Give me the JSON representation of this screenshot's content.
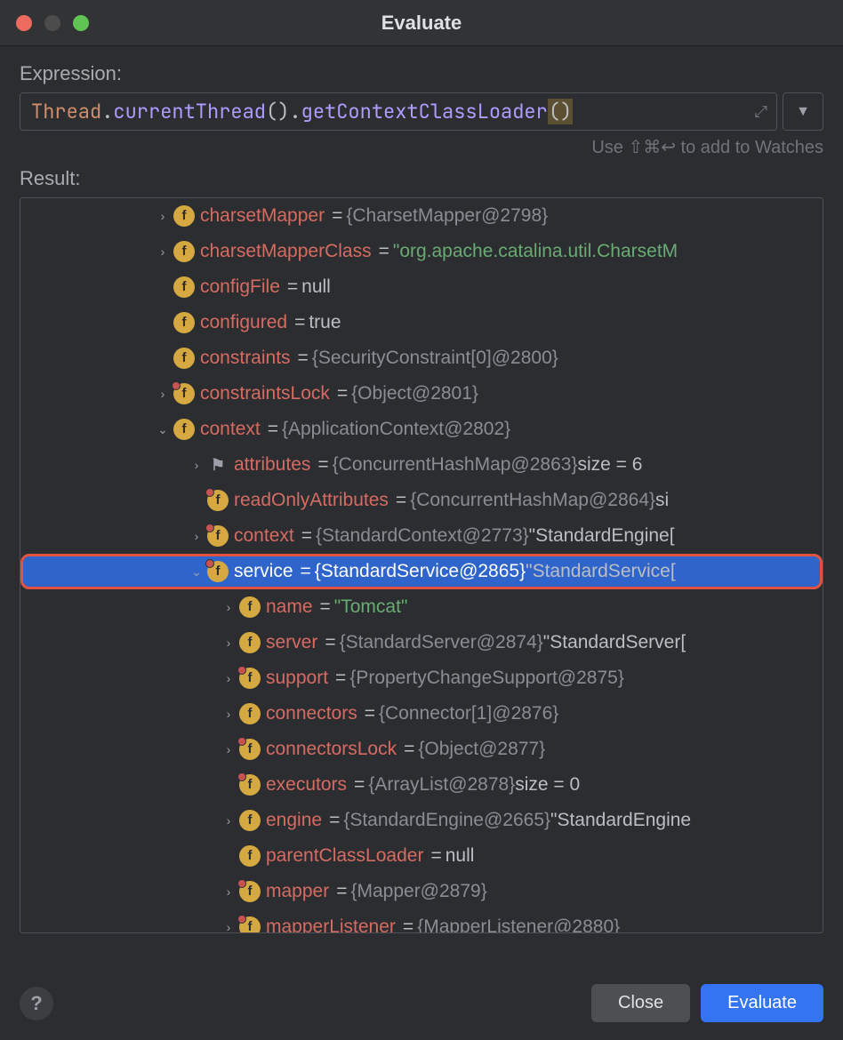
{
  "title": "Evaluate",
  "labels": {
    "expression": "Expression:",
    "result": "Result:",
    "hint": "Use ⇧⌘↩ to add to Watches",
    "close": "Close",
    "evaluate": "Evaluate"
  },
  "expression": {
    "tokens": [
      "Thread",
      ".",
      "currentThread",
      "()",
      ".",
      "getContextClassLoader",
      "()"
    ]
  },
  "rows": [
    {
      "indent": 1,
      "chev": "right",
      "icon": "f",
      "name": "charsetMapper",
      "valType": "obj",
      "val": "{CharsetMapper@2798}"
    },
    {
      "indent": 1,
      "chev": "right",
      "icon": "f",
      "name": "charsetMapperClass",
      "valType": "str",
      "val": "\"org.apache.catalina.util.CharsetM"
    },
    {
      "indent": 1,
      "chev": "none",
      "icon": "f",
      "name": "configFile",
      "valType": "null",
      "val": "null"
    },
    {
      "indent": 1,
      "chev": "none",
      "icon": "f",
      "name": "configured",
      "valType": "bool",
      "val": "true"
    },
    {
      "indent": 1,
      "chev": "none",
      "icon": "f",
      "name": "constraints",
      "valType": "obj",
      "val": "{SecurityConstraint[0]@2800}"
    },
    {
      "indent": 1,
      "chev": "right",
      "icon": "fl",
      "name": "constraintsLock",
      "valType": "obj",
      "val": "{Object@2801}"
    },
    {
      "indent": 1,
      "chev": "down",
      "icon": "f",
      "name": "context",
      "valType": "obj",
      "val": "{ApplicationContext@2802}"
    },
    {
      "indent": 2,
      "chev": "right",
      "icon": "flag",
      "name": "attributes",
      "valType": "obj",
      "val": "{ConcurrentHashMap@2863}",
      "extra": "  size = 6"
    },
    {
      "indent": 2,
      "chev": "none",
      "icon": "fl",
      "name": "readOnlyAttributes",
      "valType": "obj",
      "val": "{ConcurrentHashMap@2864}",
      "extra": "  si"
    },
    {
      "indent": 2,
      "chev": "right",
      "icon": "fl",
      "name": "context",
      "valType": "obj",
      "val": "{StandardContext@2773}",
      "extraPlain": " \"StandardEngine["
    },
    {
      "indent": 2,
      "chev": "down",
      "icon": "fl",
      "name": "service",
      "valType": "obj",
      "val": "{StandardService@2865}",
      "extraPlain": " \"StandardService[",
      "selected": true,
      "highlight": true
    },
    {
      "indent": 3,
      "chev": "right",
      "icon": "f",
      "name": "name",
      "valType": "str",
      "val": "\"Tomcat\""
    },
    {
      "indent": 3,
      "chev": "right",
      "icon": "f",
      "name": "server",
      "valType": "obj",
      "val": "{StandardServer@2874}",
      "extraPlain": " \"StandardServer["
    },
    {
      "indent": 3,
      "chev": "right",
      "icon": "fl",
      "name": "support",
      "valType": "obj",
      "val": "{PropertyChangeSupport@2875}"
    },
    {
      "indent": 3,
      "chev": "right",
      "icon": "f",
      "name": "connectors",
      "valType": "obj",
      "val": "{Connector[1]@2876}"
    },
    {
      "indent": 3,
      "chev": "right",
      "icon": "fl",
      "name": "connectorsLock",
      "valType": "obj",
      "val": "{Object@2877}"
    },
    {
      "indent": 3,
      "chev": "none",
      "icon": "fl",
      "name": "executors",
      "valType": "obj",
      "val": "{ArrayList@2878}",
      "extra": "  size = 0"
    },
    {
      "indent": 3,
      "chev": "right",
      "icon": "f",
      "name": "engine",
      "valType": "obj",
      "val": "{StandardEngine@2665}",
      "extraPlain": " \"StandardEngine"
    },
    {
      "indent": 3,
      "chev": "none",
      "icon": "f",
      "name": "parentClassLoader",
      "valType": "null",
      "val": "null"
    },
    {
      "indent": 3,
      "chev": "right",
      "icon": "fl",
      "name": "mapper",
      "valType": "obj",
      "val": "{Mapper@2879}"
    },
    {
      "indent": 3,
      "chev": "right",
      "icon": "fl",
      "name": "mapperListener",
      "valType": "obj",
      "val": "{MapperListener@2880}"
    }
  ]
}
